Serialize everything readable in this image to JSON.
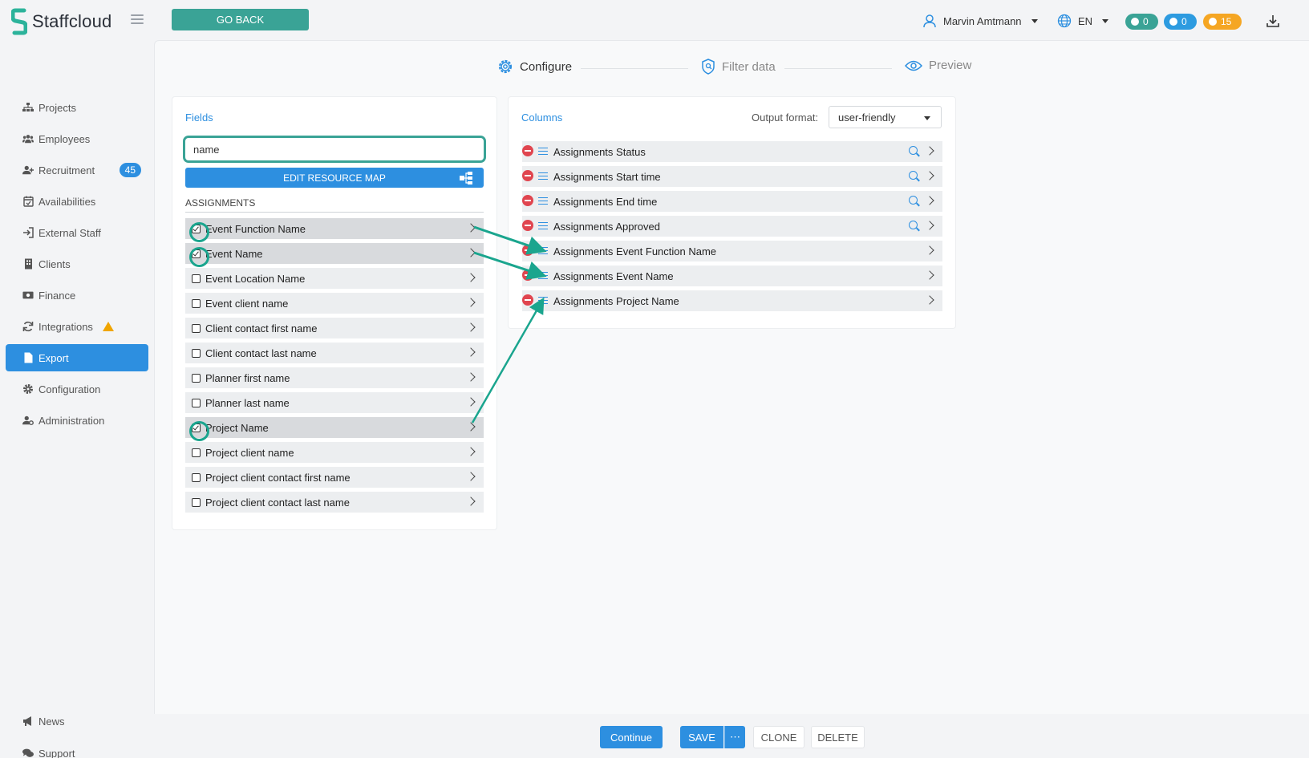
{
  "app": {
    "name": "Staffcloud"
  },
  "topbar": {
    "go_back": "GO BACK",
    "user_name": "Marvin Amtmann",
    "language": "EN",
    "counters": {
      "messages": "0",
      "notifications": "0",
      "warnings": "15"
    }
  },
  "sidebar": {
    "items": [
      {
        "label": "Projects",
        "icon": "sitemap-icon"
      },
      {
        "label": "Employees",
        "icon": "users-icon"
      },
      {
        "label": "Recruitment",
        "icon": "user-plus-icon",
        "badge": "45"
      },
      {
        "label": "Availabilities",
        "icon": "calendar-check-icon"
      },
      {
        "label": "External Staff",
        "icon": "sign-in-icon"
      },
      {
        "label": "Clients",
        "icon": "building-icon"
      },
      {
        "label": "Finance",
        "icon": "money-icon"
      },
      {
        "label": "Integrations",
        "icon": "sync-icon",
        "warning": true
      },
      {
        "label": "Export",
        "icon": "file-icon",
        "active": true
      },
      {
        "label": "Configuration",
        "icon": "gear-icon"
      },
      {
        "label": "Administration",
        "icon": "user-gear-icon"
      }
    ],
    "bottom": [
      {
        "label": "News",
        "icon": "megaphone-icon"
      },
      {
        "label": "Support",
        "icon": "comments-icon"
      }
    ]
  },
  "steps": [
    {
      "label": "Configure",
      "icon": "gear-icon",
      "active": true
    },
    {
      "label": "Filter data",
      "icon": "shield-icon",
      "active": false
    },
    {
      "label": "Preview",
      "icon": "eye-icon",
      "active": false
    }
  ],
  "fields": {
    "title": "Fields",
    "search_value": "name",
    "edit_resource_map": "EDIT RESOURCE MAP",
    "section": "ASSIGNMENTS",
    "items": [
      {
        "label": "Event Function Name",
        "checked": true
      },
      {
        "label": "Event Name",
        "checked": true
      },
      {
        "label": "Event Location Name",
        "checked": false
      },
      {
        "label": "Event client name",
        "checked": false
      },
      {
        "label": "Client contact first name",
        "checked": false
      },
      {
        "label": "Client contact last name",
        "checked": false
      },
      {
        "label": "Planner first name",
        "checked": false
      },
      {
        "label": "Planner last name",
        "checked": false
      },
      {
        "label": "Project Name",
        "checked": true
      },
      {
        "label": "Project client name",
        "checked": false
      },
      {
        "label": "Project client contact first name",
        "checked": false
      },
      {
        "label": "Project client contact last name",
        "checked": false
      }
    ]
  },
  "columns": {
    "title": "Columns",
    "output_format_label": "Output format:",
    "output_format_value": "user-friendly",
    "items": [
      {
        "label": "Assignments Status",
        "searchable": true
      },
      {
        "label": "Assignments Start time",
        "searchable": true
      },
      {
        "label": "Assignments End time",
        "searchable": true
      },
      {
        "label": "Assignments Approved",
        "searchable": true
      },
      {
        "label": "Assignments Event Function Name",
        "searchable": false
      },
      {
        "label": "Assignments Event Name",
        "searchable": false
      },
      {
        "label": "Assignments Project Name",
        "searchable": false
      }
    ]
  },
  "footer": {
    "continue": "Continue",
    "save": "SAVE",
    "more": "⋯",
    "clone": "CLONE",
    "delete": "DELETE"
  },
  "colors": {
    "brand_teal": "#3aa396",
    "primary_blue": "#2d8fe0",
    "danger_red": "#e0454f",
    "warning_orange": "#f5a623",
    "annotation_teal": "#1aa58e"
  }
}
